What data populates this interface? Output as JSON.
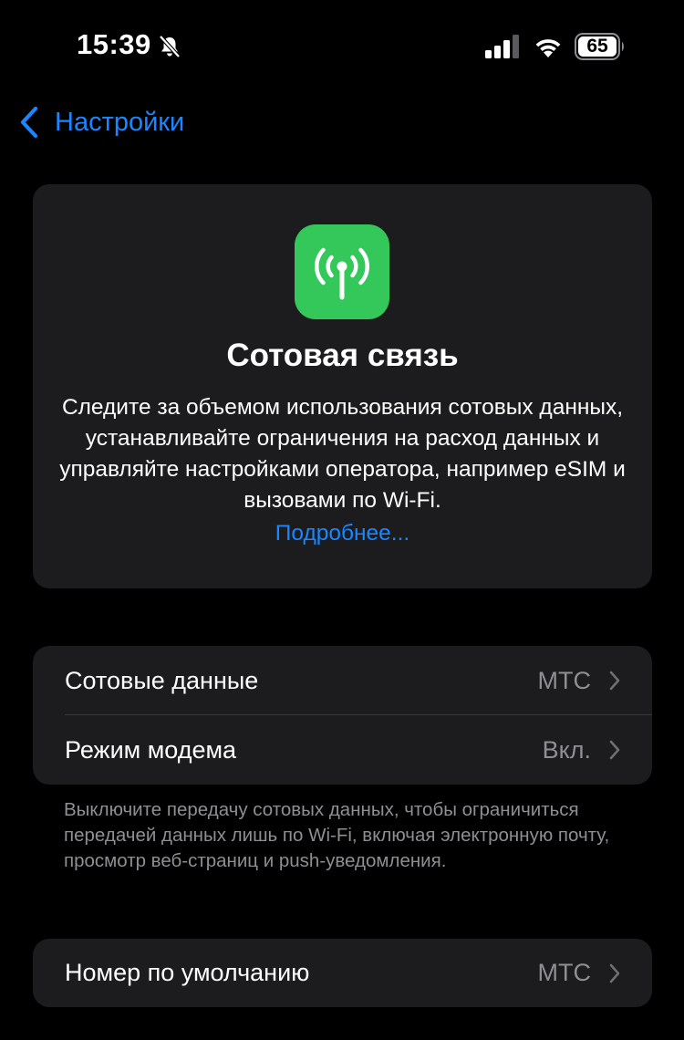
{
  "status_bar": {
    "time": "15:39",
    "battery_level": "65"
  },
  "nav": {
    "back_label": "Настройки"
  },
  "hero": {
    "title": "Сотовая связь",
    "description": "Следите за объемом использования сотовых данных, устанавливайте ограничения на расход данных и управляйте настройками оператора, например eSIM и вызовами по Wi‑Fi.",
    "link": "Подробнее..."
  },
  "group1": {
    "rows": [
      {
        "label": "Сотовые данные",
        "value": "МТС"
      },
      {
        "label": "Режим модема",
        "value": "Вкл."
      }
    ]
  },
  "footnote": "Выключите передачу сотовых данных, чтобы ограничиться передачей данных лишь по Wi‑Fi, включая электронную почту, просмотр веб-страниц и push-уведомления.",
  "group2": {
    "rows": [
      {
        "label": "Номер по умолчанию",
        "value": "МТС"
      }
    ]
  },
  "colors": {
    "accent": "#1a86ff",
    "icon_green": "#34c759",
    "card_bg": "#1c1c1e",
    "secondary_text": "#8e8e93"
  },
  "icons": {
    "hero": "antenna-icon",
    "back": "chevron-left-icon",
    "row": "chevron-right-icon"
  }
}
